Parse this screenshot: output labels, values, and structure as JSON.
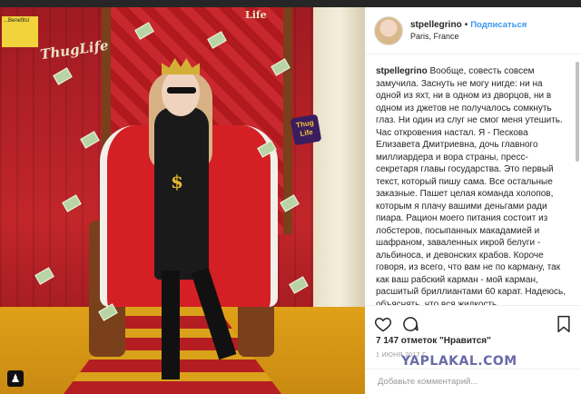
{
  "post": {
    "photo_texts": {
      "thuglife_banner": "ThugLife",
      "life_top": "Life",
      "thug_badge": "Thug Life",
      "dollar": "$",
      "sticker": "...Benefitsl"
    },
    "header": {
      "username": "stpellegrino",
      "separator": "•",
      "follow_label": "Подписаться",
      "location": "Paris, France"
    },
    "caption": {
      "username": "stpellegrino",
      "text": "Вообще, совесть совсем замучила. Заснуть не могу нигде: ни на одной из яхт, ни в одном из дворцов, ни в одном из джетов не получалось сомкнуть глаз. Ни один из слуг не смог меня утешить. Час откровения настал. Я - Пескова Елизавета Дмитриевна, дочь главного миллиардера и вора страны, пресс-секретаря главы государства. Это первый текст, который пишу сама. Все остальные заказные. Пашет целая команда холопов, которым я плачу вашими деньгами ради пиара. Рацион моего питания состоит из лобстеров, посыпанных макадамией и шафраном, заваленных икрой белуги - альбиноса, и девонских крабов. Короче говоря, из всего, что вам не по карману, так как ваш рабский карман - мой карман, расшитый бриллиантами 60 карат. Надеюсь, объяснять, что вся жидкость"
    },
    "likes": "7 147 отметок \"Нравится\"",
    "date": "1 ИЮНЯ 2017 Г.",
    "comment_placeholder": "Добавьте комментарий...",
    "icons": [
      "heart-icon",
      "comment-icon",
      "share-icon",
      "bookmark-icon"
    ]
  },
  "watermark": "YAPLAKAL.COM",
  "colors": {
    "follow": "#3897f0",
    "text": "#262626",
    "muted": "#999999",
    "backdrop": "#262626"
  }
}
